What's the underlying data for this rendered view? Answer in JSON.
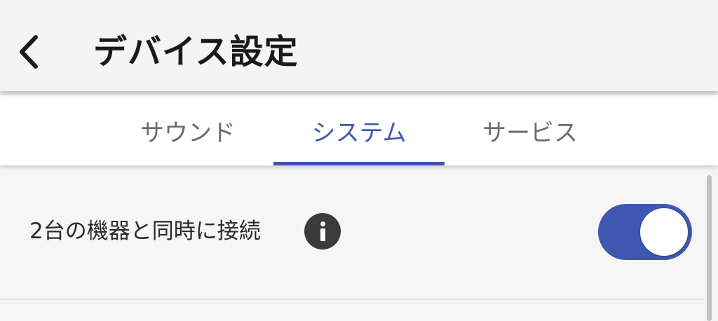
{
  "app_bar": {
    "back_icon": "chevron-left-icon",
    "title": "デバイス設定"
  },
  "tabs": [
    {
      "label": "サウンド",
      "active": false
    },
    {
      "label": "システム",
      "active": true
    },
    {
      "label": "サービス",
      "active": false
    }
  ],
  "settings": {
    "dual_connection": {
      "label": "2台の機器と同時に接続",
      "info_icon": "info-icon",
      "enabled": true
    }
  },
  "colors": {
    "accent": "#3f57b0",
    "info_icon": "#3b3b3b",
    "tab_inactive": "#6b6b6b",
    "title": "#1a1a1a"
  }
}
